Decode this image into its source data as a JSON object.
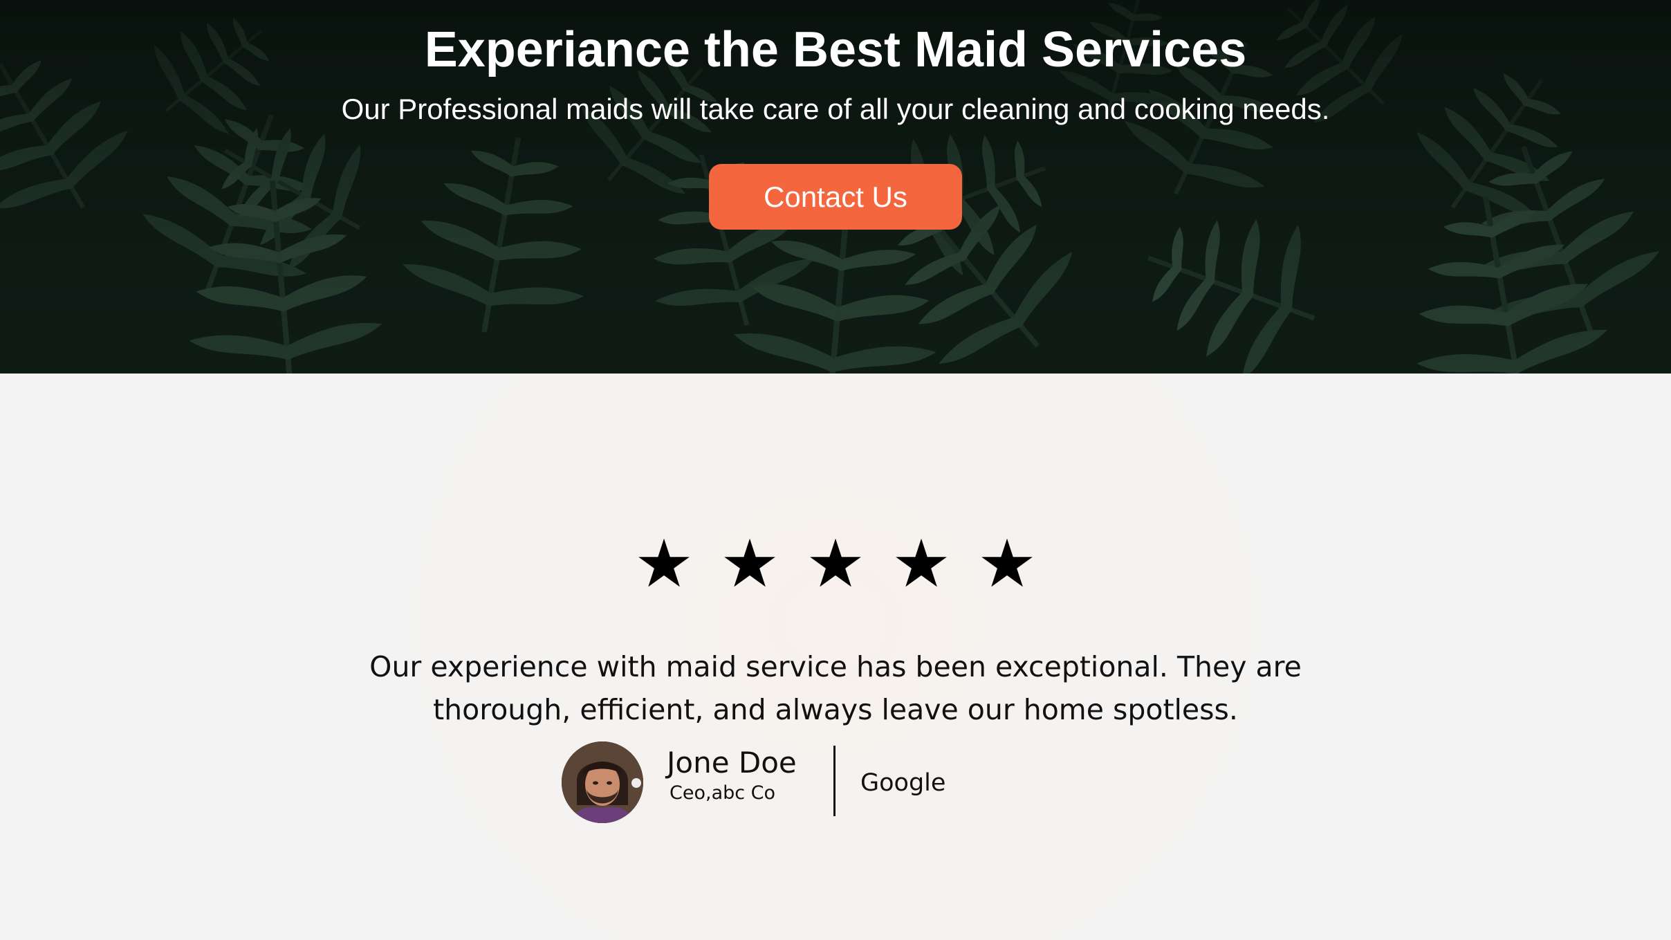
{
  "hero": {
    "title": "Experiance the Best Maid Services",
    "subtitle": "Our Professional maids will take care of all your cleaning and cooking needs.",
    "cta_label": "Contact Us",
    "background_image": "dark-green-fern-leaves",
    "accent_color": "#f4673e"
  },
  "testimonial": {
    "rating": 5,
    "stars": [
      "★",
      "★",
      "★",
      "★",
      "★"
    ],
    "quote": "Our experience with maid service has been exceptional. They are thorough, efficient, and always leave our home spotless.",
    "author": {
      "name": "Jone Doe",
      "role": "Ceo,abc Co",
      "avatar_icon": "person-portrait-avatar"
    },
    "source": "Google"
  }
}
